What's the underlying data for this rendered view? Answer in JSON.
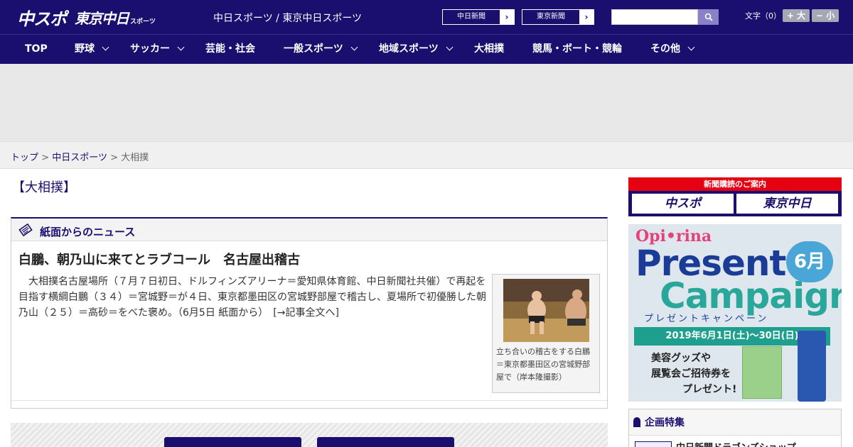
{
  "header": {
    "logo_main": "中スポ",
    "logo_tokyo": "東京中日",
    "logo_sports": "スポーツ",
    "site_title": "中日スポーツ / 東京中日スポーツ",
    "paper_links": [
      "中日新聞",
      "東京新聞"
    ],
    "search_placeholder": "",
    "font_size_label": "文字（0）",
    "font_bigger": "+ 大",
    "font_smaller": "− 小"
  },
  "nav": {
    "items": [
      {
        "label": "TOP",
        "dropdown": false
      },
      {
        "label": "野球",
        "dropdown": true
      },
      {
        "label": "サッカー",
        "dropdown": true
      },
      {
        "label": "芸能・社会",
        "dropdown": false
      },
      {
        "label": "一般スポーツ",
        "dropdown": true
      },
      {
        "label": "地域スポーツ",
        "dropdown": true
      },
      {
        "label": "大相撲",
        "dropdown": false
      },
      {
        "label": "競馬・ボート・競輪",
        "dropdown": false
      },
      {
        "label": "その他",
        "dropdown": true
      }
    ]
  },
  "breadcrumb": {
    "home": "トップ",
    "section": "中日スポーツ",
    "current": "大相撲",
    "sep": ">"
  },
  "page": {
    "title": "【大相撲】"
  },
  "news": {
    "heading": "紙面からのニュース",
    "article_title": "白鵬、朝乃山に来てとラブコール　名古屋出稽古",
    "article_body": "大相撲名古屋場所（７月７日初日、ドルフィンズアリーナ＝愛知県体育館、中日新聞社共催）で再起を目指す横綱白鵬（３４）＝宮城野＝が４日、東京都墨田区の宮城野部屋で稽古し、夏場所で初優勝した朝乃山（２５）＝高砂＝をべた褒め。（6月5日 紙面から）　[→記事全文へ]",
    "photo_caption": "立ち合いの稽古をする白鵬＝東京都墨田区の宮城野部屋で（岸本隆撮影）"
  },
  "sidebar": {
    "subscribe_title": "新聞購読のご案内",
    "subscribe_buttons": [
      "中スポ",
      "東京中日"
    ],
    "campaign": {
      "brand": "Opi•rina",
      "present": "Present",
      "campaign_word": "Campaign",
      "month": "6月",
      "kana": "プレゼントキャンペーン",
      "date": "2019年6月1日(土)〜30日(日)",
      "line1": "美容グッズや",
      "line2": "展覧会ご招待券を",
      "line3": "プレゼント!"
    },
    "feature_heading": "企画特集",
    "feature_item": "中日新聞ドラゴンズショップ"
  },
  "colors": {
    "brand_navy": "#1a0e6e",
    "subscribe_red": "#e50012"
  }
}
